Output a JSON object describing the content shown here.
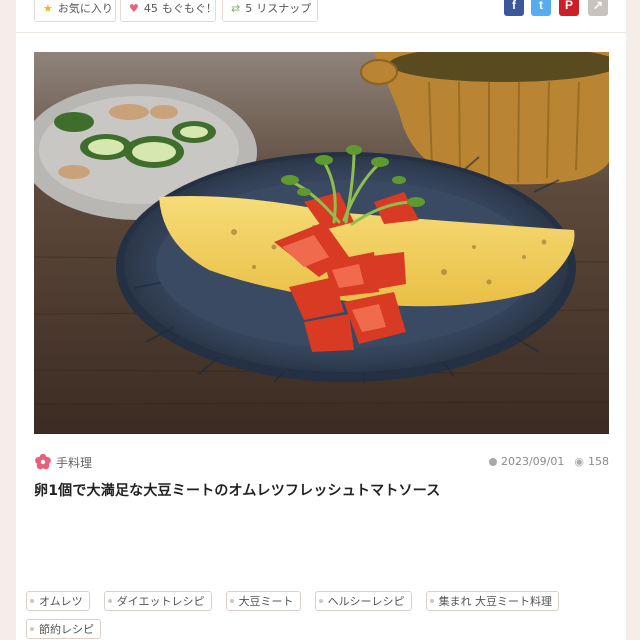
{
  "actions": {
    "favorite": {
      "label": "お気に入り",
      "icon": "star-icon"
    },
    "mogumogu": {
      "count": "45",
      "label": "もぐもぐ！",
      "icon": "heart-icon"
    },
    "reshare": {
      "count": "5",
      "label": "リスナップ",
      "icon": "repost-icon"
    }
  },
  "share": {
    "facebook": {
      "glyph": "f",
      "color": "#3b5998"
    },
    "twitter": {
      "glyph": "t",
      "color": "#55acee"
    },
    "pinterest": {
      "glyph": "P",
      "color": "#cb2027"
    },
    "other": {
      "glyph": "↗",
      "color": "#c9c3bf"
    }
  },
  "post": {
    "category": "手料理",
    "date": "2023/09/01",
    "views": "158",
    "title": "卵1個で大満足な大豆ミートのオムレツフレッシュトマトソース"
  },
  "tags": [
    "オムレツ",
    "ダイエットレシピ",
    "大豆ミート",
    "ヘルシーレシピ",
    "集まれ 大豆ミート料理",
    "節約レシピ"
  ],
  "colors": {
    "accent": "#e8607a",
    "page_bg": "#f5ede8"
  }
}
